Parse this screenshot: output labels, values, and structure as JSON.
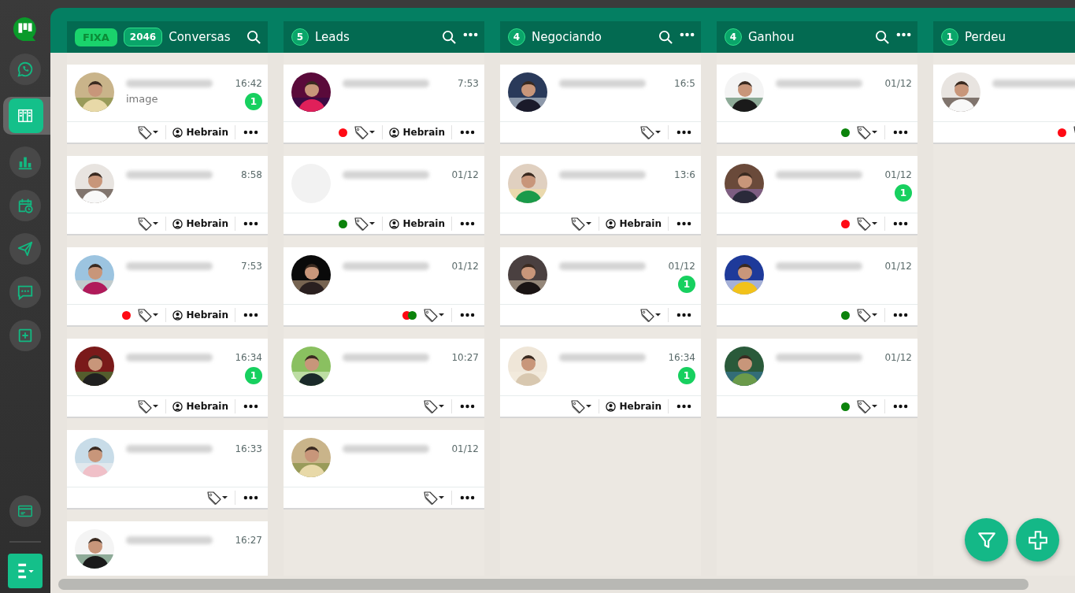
{
  "sidebar": {
    "items": [
      {
        "kind": "whatsapp",
        "selected": false
      },
      {
        "kind": "kanban",
        "selected": true
      },
      {
        "kind": "chart",
        "selected": false
      },
      {
        "kind": "calendar",
        "selected": false
      },
      {
        "kind": "send",
        "selected": false
      },
      {
        "kind": "chat",
        "selected": false
      },
      {
        "kind": "add",
        "selected": false
      }
    ],
    "bottom_items": [
      {
        "kind": "card"
      }
    ]
  },
  "columns": [
    {
      "title": "Conversas",
      "pinned_label": "FIXA",
      "count": "2046",
      "search": true,
      "menu": false,
      "cards": [
        {
          "name_redacted": true,
          "time": "16:42",
          "unread": "1",
          "preview": "image",
          "agent": "Hebrain",
          "avatar": {
            "kind": "picture"
          }
        },
        {
          "name_redacted": true,
          "time": "8:58",
          "agent": "Hebrain",
          "avatar": {
            "kind": "picture"
          }
        },
        {
          "name_redacted": true,
          "time": "7:53",
          "agent": "Hebrain",
          "dots": [
            {
              "color": "#ff0a14"
            }
          ],
          "avatar": {
            "kind": "picture"
          }
        },
        {
          "name_redacted": true,
          "time": "16:34",
          "unread": "1",
          "agent": "Hebrain",
          "avatar": {
            "kind": "picture"
          }
        },
        {
          "name_redacted": true,
          "time": "16:33",
          "avatar": {
            "kind": "picture"
          }
        },
        {
          "name_redacted": true,
          "time": "16:27",
          "avatar": {
            "kind": "picture"
          }
        }
      ]
    },
    {
      "title": "Leads",
      "count": "5",
      "search": true,
      "menu": true,
      "cards": [
        {
          "name_redacted": true,
          "time": "7:53",
          "agent": "Hebrain",
          "dots": [
            {
              "color": "#ff0a14"
            }
          ],
          "avatar": {
            "kind": "picture"
          }
        },
        {
          "name_redacted": true,
          "time": "01/12",
          "agent": "Hebrain",
          "dots": [
            {
              "color": "#0b830b"
            }
          ],
          "avatar": {
            "kind": "blank"
          }
        },
        {
          "name_redacted": true,
          "time": "01/12",
          "dots": [
            {
              "color": "#ff0a14"
            },
            {
              "color": "#0b830b"
            }
          ],
          "avatar": {
            "kind": "picture"
          }
        },
        {
          "name_redacted": true,
          "time": "10:27",
          "avatar": {
            "kind": "picture"
          }
        },
        {
          "name_redacted": true,
          "time": "01/12",
          "avatar": {
            "kind": "picture"
          }
        }
      ]
    },
    {
      "title": "Negociando",
      "count": "4",
      "search": true,
      "menu": true,
      "cards": [
        {
          "name_redacted": true,
          "time": "16:5",
          "avatar": {
            "kind": "picture"
          }
        },
        {
          "name_redacted": true,
          "time": "13:6",
          "agent": "Hebrain",
          "avatar": {
            "kind": "picture"
          }
        },
        {
          "name_redacted": true,
          "time": "01/12",
          "unread": "1",
          "avatar": {
            "kind": "picture"
          }
        },
        {
          "name_redacted": true,
          "time": "16:34",
          "unread": "1",
          "agent": "Hebrain",
          "avatar": {
            "kind": "picture"
          }
        }
      ]
    },
    {
      "title": "Ganhou",
      "count": "4",
      "search": true,
      "menu": true,
      "cards": [
        {
          "name_redacted": true,
          "time": "01/12",
          "dots": [
            {
              "color": "#0b830b"
            }
          ],
          "avatar": {
            "kind": "picture"
          }
        },
        {
          "name_redacted": true,
          "time": "01/12",
          "unread": "1",
          "dots": [
            {
              "color": "#ff0a14"
            }
          ],
          "avatar": {
            "kind": "picture"
          }
        },
        {
          "name_redacted": true,
          "time": "01/12",
          "dots": [
            {
              "color": "#0b830b"
            }
          ],
          "avatar": {
            "kind": "picture"
          }
        },
        {
          "name_redacted": true,
          "time": "01/12",
          "dots": [
            {
              "color": "#0b830b"
            }
          ],
          "avatar": {
            "kind": "picture"
          }
        }
      ]
    },
    {
      "title": "Perdeu",
      "count": "1",
      "search": false,
      "menu": false,
      "cards": [
        {
          "name_redacted": true,
          "dots": [
            {
              "color": "#ff0a14"
            }
          ],
          "avatar": {
            "kind": "picture"
          }
        }
      ]
    }
  ]
}
